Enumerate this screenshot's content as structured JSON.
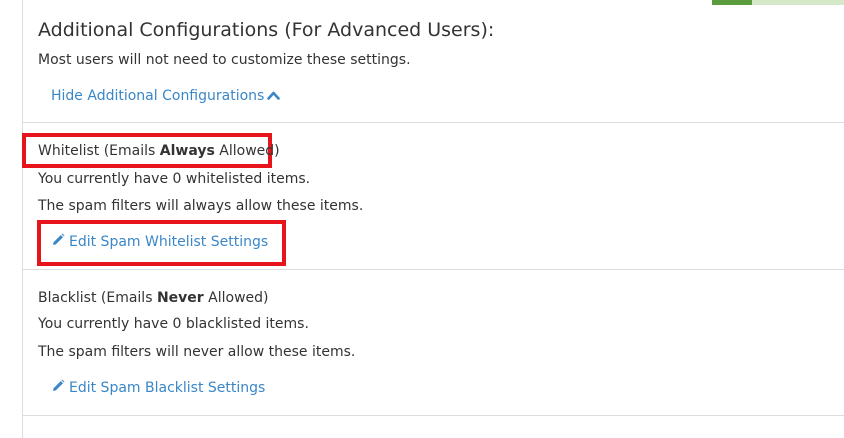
{
  "advanced": {
    "title": "Additional Configurations (For Advanced Users):",
    "subtitle": "Most users will not need to customize these settings.",
    "toggle_label": "Hide Additional Configurations"
  },
  "whitelist": {
    "heading_prefix": "Whitelist (Emails ",
    "heading_emphasis": "Always",
    "heading_suffix": " Allowed)",
    "count_text": "You currently have 0 whitelisted items.",
    "description": "The spam filters will always allow these items.",
    "edit_label": "Edit Spam Whitelist Settings"
  },
  "blacklist": {
    "heading_prefix": "Blacklist (Emails ",
    "heading_emphasis": "Never",
    "heading_suffix": " Allowed)",
    "count_text": "You currently have 0 blacklisted items.",
    "description": "The spam filters will never allow these items.",
    "edit_label": "Edit Spam Blacklist Settings"
  },
  "colors": {
    "link": "#3a87c8",
    "highlight": "#e8141c",
    "tab_active": "#5b9c3e"
  },
  "icons": {
    "toggle": "chevron-up-icon",
    "edit": "pencil-icon"
  }
}
